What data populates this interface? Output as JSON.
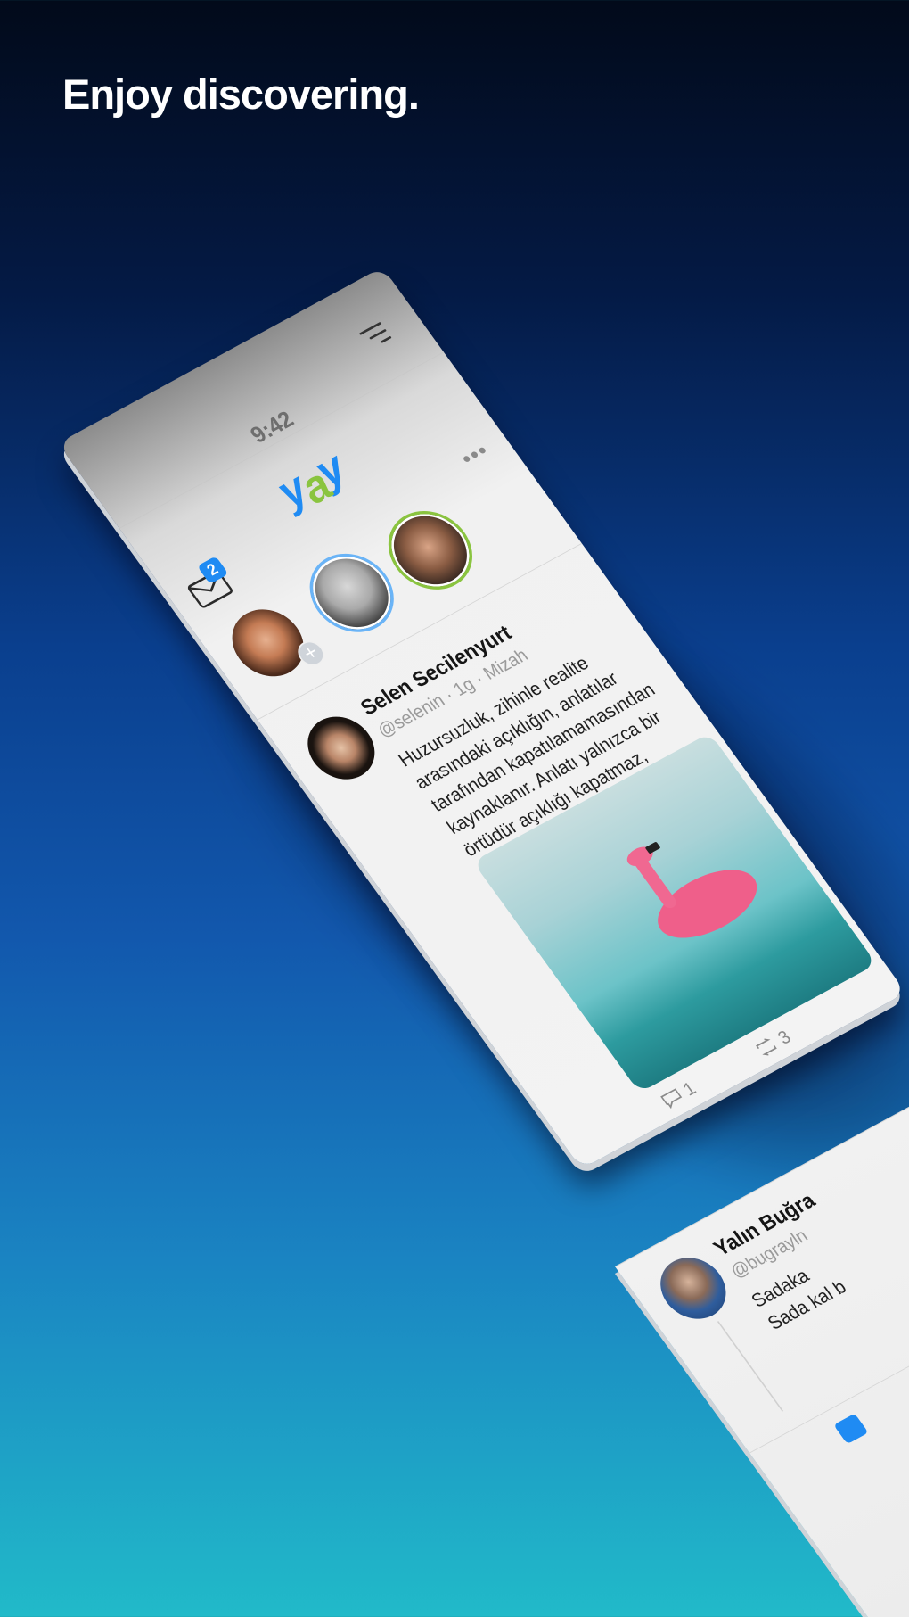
{
  "headline": "Enjoy discovering.",
  "app": {
    "status_time": "9:42",
    "logo": {
      "part1": "y",
      "part2": "a",
      "part3": "y"
    },
    "messages_badge": "2",
    "more_glyph": "•••"
  },
  "post": {
    "author": "Selen Secilenyurt",
    "handle": "@selenin",
    "age": "1g",
    "category": "Mizah",
    "sep": "·",
    "text": "Huzursuzluk, zihinle realite arasındaki açıklığın, anlatılar tarafından kapatılamamasından kaynaklanır. Anlatı yalnızca bir örtüdür açıklığı kapatmaz, sadece gizler.",
    "comments": "1",
    "reposts": "3"
  },
  "reply": {
    "author": "Yalın Buğra",
    "handle": "@bugrayln",
    "text": "Sadaka Sada kal b"
  },
  "icons": {
    "mail": "mail-icon",
    "menu": "menu-icon",
    "comment": "comment-icon",
    "repost": "repost-icon",
    "home": "home-icon",
    "more": "more-icon"
  },
  "colors": {
    "accent": "#1f8bf3",
    "logo_green": "#8ac43f"
  }
}
